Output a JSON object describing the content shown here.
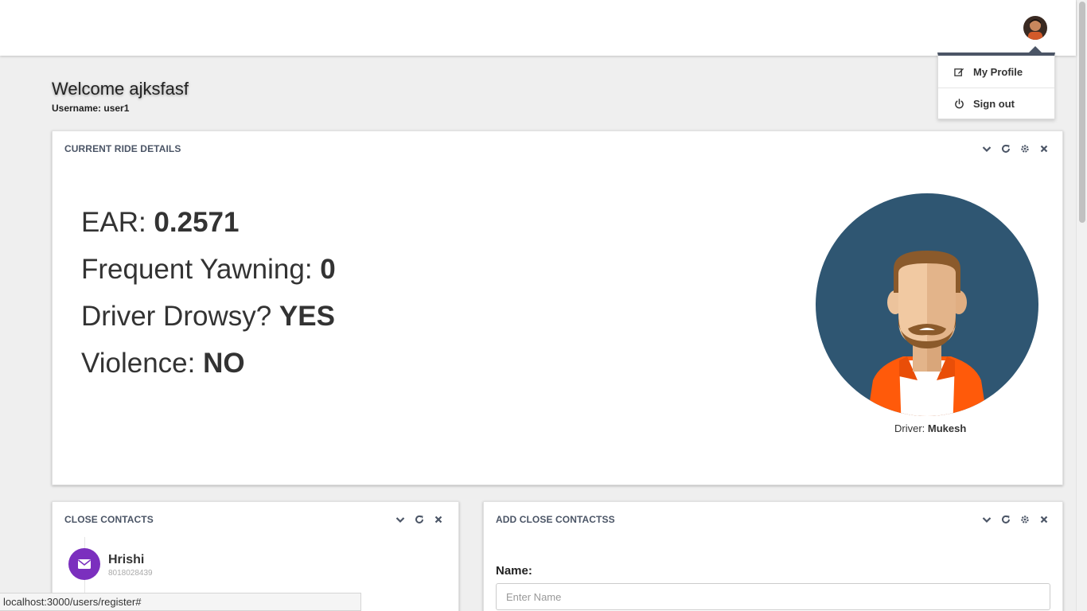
{
  "header": {
    "profile_menu": {
      "items": [
        {
          "label": "My Profile",
          "icon": "edit-icon"
        },
        {
          "label": "Sign out",
          "icon": "power-icon"
        }
      ]
    }
  },
  "welcome": {
    "title": "Welcome ajksfasf",
    "username": "Username: user1"
  },
  "ride_panel": {
    "title": "CURRENT RIDE DETAILS",
    "stats": [
      {
        "label": "EAR: ",
        "value": "0.2571"
      },
      {
        "label": "Frequent Yawning: ",
        "value": "0"
      },
      {
        "label": "Driver Drowsy? ",
        "value": "YES"
      },
      {
        "label": "Violence: ",
        "value": "NO"
      }
    ],
    "driver_label": "Driver: ",
    "driver_name": "Mukesh"
  },
  "contacts_panel": {
    "title": "CLOSE CONTACTS",
    "contacts": [
      {
        "name": "Hrishi",
        "phone": "8018028439",
        "color": "#7b2fbe"
      }
    ]
  },
  "add_contact_panel": {
    "title": "ADD CLOSE CONTACTSS",
    "name_label": "Name:",
    "name_placeholder": "Enter Name"
  },
  "status_bar": {
    "url": "localhost:3000/users/register#"
  },
  "colors": {
    "accent": "#4b5566",
    "avatar_bg": "#2f5672",
    "contact_icon_bg": "#7b2fbe"
  }
}
